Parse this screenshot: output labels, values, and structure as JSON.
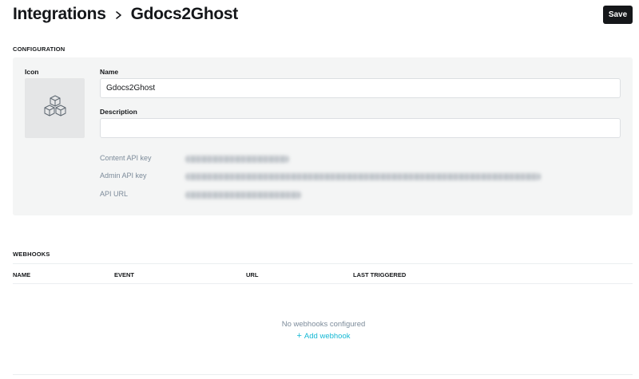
{
  "header": {
    "breadcrumb_parent": "Integrations",
    "title": "Gdocs2Ghost",
    "save_label": "Save"
  },
  "configuration": {
    "section_label": "CONFIGURATION",
    "icon_label": "Icon",
    "icon_name": "cubes-icon",
    "name_label": "Name",
    "name_value": "Gdocs2Ghost",
    "description_label": "Description",
    "description_value": "",
    "content_api_key_label": "Content API key",
    "admin_api_key_label": "Admin API key",
    "api_url_label": "API URL"
  },
  "webhooks": {
    "section_label": "WEBHOOKS",
    "columns": [
      "NAME",
      "EVENT",
      "URL",
      "LAST TRIGGERED"
    ],
    "empty_text": "No webhooks configured",
    "add_label": "Add webhook"
  },
  "colors": {
    "accent": "#14b8d4",
    "button_bg": "#15171a",
    "panel_bg": "#f4f5f5",
    "muted_text": "#7c8b9a"
  }
}
